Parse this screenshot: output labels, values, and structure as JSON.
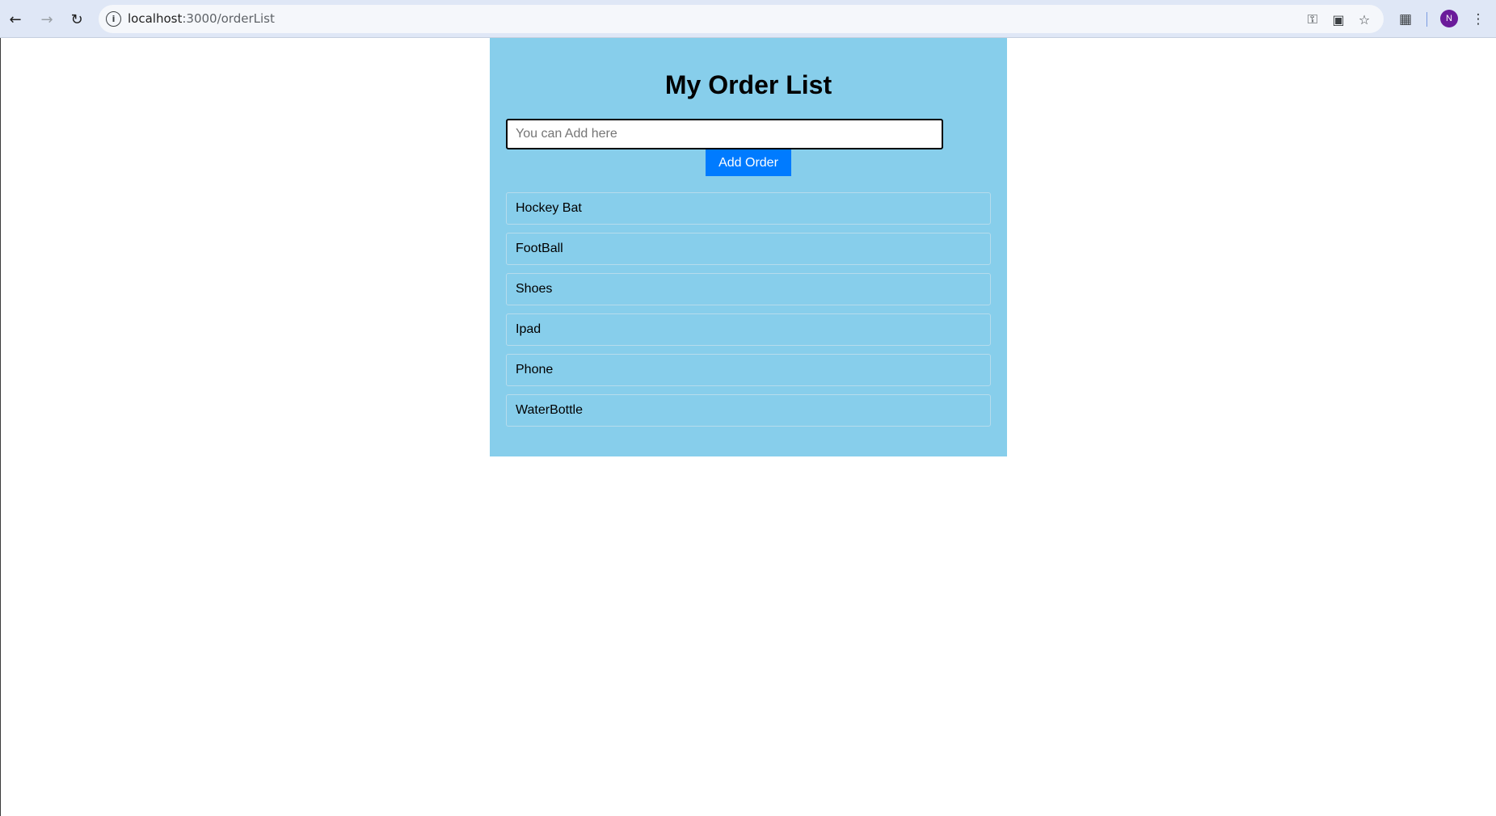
{
  "browser": {
    "url_host": "localhost",
    "url_rest": ":3000/orderList",
    "avatar_initial": "N",
    "icons": [
      "back-arrow-icon",
      "forward-arrow-icon",
      "reload-icon",
      "site-info-icon",
      "password-key-icon",
      "install-app-icon",
      "bookmark-star-icon",
      "extensions-icon",
      "more-menu-icon"
    ]
  },
  "page": {
    "title": "My Order List",
    "input_placeholder": "You can Add here",
    "input_value": "",
    "add_button_label": "Add Order",
    "orders": [
      {
        "label": "Hockey Bat"
      },
      {
        "label": "FootBall"
      },
      {
        "label": "Shoes"
      },
      {
        "label": "Ipad"
      },
      {
        "label": "Phone"
      },
      {
        "label": "WaterBottle"
      }
    ]
  },
  "colors": {
    "panel_background": "#87ceeb",
    "button_background": "#007bff",
    "button_text": "#ffffff"
  }
}
